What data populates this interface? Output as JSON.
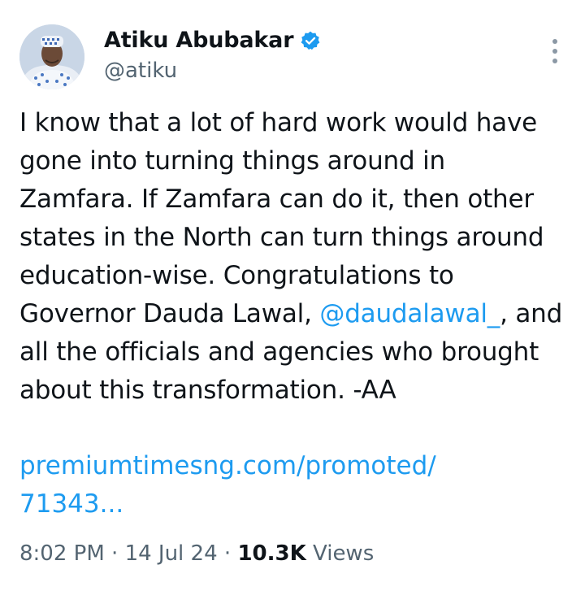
{
  "author": {
    "name": "Atiku Abubakar",
    "handle": "@atiku",
    "verified_icon": "verified-badge-icon",
    "verified_color": "#1d9bf0"
  },
  "tweet": {
    "text_part1": "I know that a lot of hard work would have gone into turning things around in Zamfara. If Zamfara can do it, then other states in the North can turn things around education-wise. Congratulations to Governor Dauda Lawal, ",
    "mention": "@daudalawal_",
    "text_part2": ", and all the officials and agencies who brought about this transformation. -AA",
    "link_line1": "premiumtimesng.com/promoted/",
    "link_line2": "71343..."
  },
  "meta": {
    "time": "8:02 PM",
    "separator1": " · ",
    "date": "14 Jul 24",
    "separator2": " · ",
    "views_count": "10.3K",
    "views_label": " Views"
  },
  "more_icon": "more-options-icon",
  "link_color": "#1d9bf0"
}
